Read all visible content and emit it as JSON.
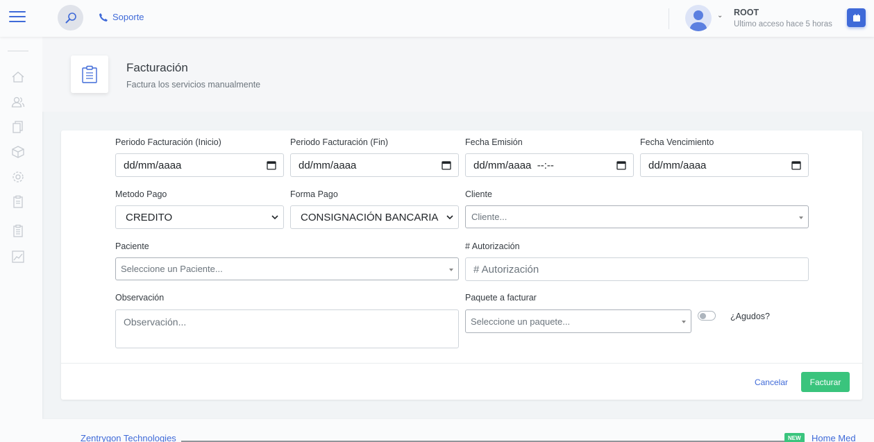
{
  "header": {
    "support_label": "Soporte",
    "user_name": "ROOT",
    "user_sub": "Ultimo acceso hace 5 horas"
  },
  "colors": {
    "primary": "#3f6ad8",
    "success": "#3ac47d",
    "background": "#f1f4f6"
  },
  "sidebar": {
    "icons": [
      "home-icon",
      "users-icon",
      "documents-icon",
      "box-icon",
      "settings-icon",
      "clipboard-icon",
      "clipboard-list-icon",
      "chart-icon"
    ]
  },
  "page": {
    "title": "Facturación",
    "subtitle": "Factura los servicios manualmente"
  },
  "form": {
    "periodo_inicio": {
      "label": "Periodo Facturación (Inicio)",
      "value": "dd/mm/aaaa"
    },
    "periodo_fin": {
      "label": "Periodo Facturación (Fin)",
      "value": "dd/mm/aaaa"
    },
    "fecha_emision": {
      "label": "Fecha Emisión",
      "value": "dd/mm/aaaa  --:--"
    },
    "fecha_vencimiento": {
      "label": "Fecha Vencimiento",
      "value": "dd/mm/aaaa"
    },
    "metodo_pago": {
      "label": "Metodo Pago",
      "value": "CREDITO"
    },
    "forma_pago": {
      "label": "Forma Pago",
      "value": "CONSIGNACIÓN BANCARIA"
    },
    "cliente": {
      "label": "Cliente",
      "placeholder": "Cliente..."
    },
    "paciente": {
      "label": "Paciente",
      "placeholder": "Seleccione un Paciente..."
    },
    "autorizacion": {
      "label": "# Autorización",
      "placeholder": "# Autorización"
    },
    "observacion": {
      "label": "Observación",
      "placeholder": "Observación..."
    },
    "paquete": {
      "label": "Paquete a facturar",
      "placeholder": "Seleccione un paquete..."
    },
    "agudos": {
      "label": "¿Agudos?",
      "checked": false
    }
  },
  "actions": {
    "cancel_label": "Cancelar",
    "submit_label": "Facturar"
  },
  "footer": {
    "left_text": "Zentrygon Technologies",
    "badge": "NEW",
    "right_text": "Home Med"
  }
}
